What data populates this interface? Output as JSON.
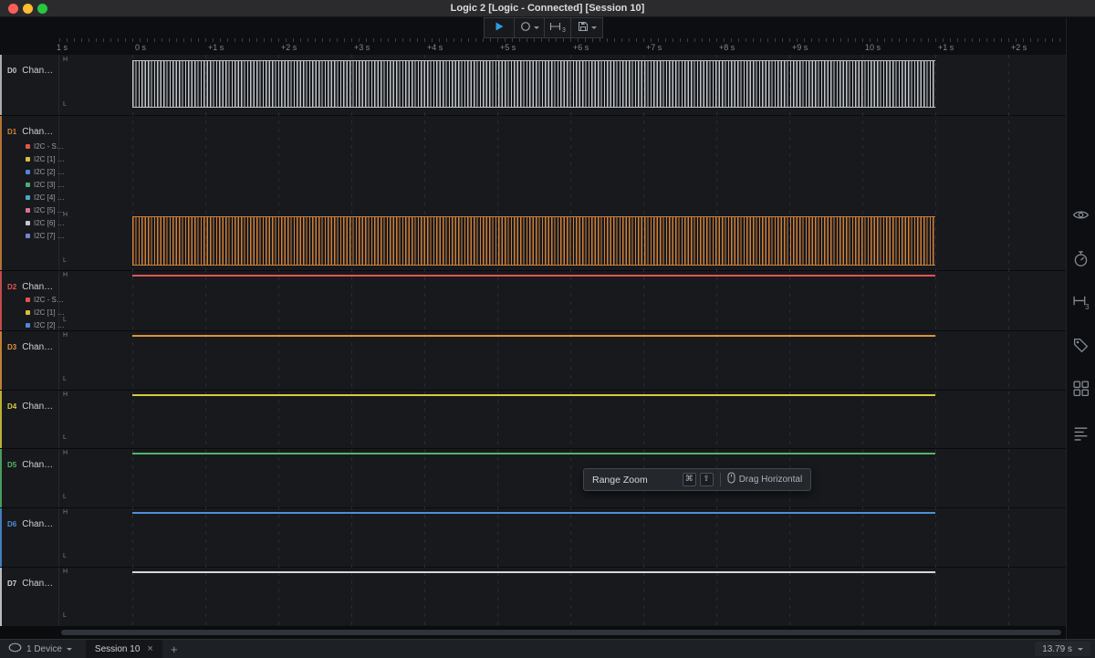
{
  "window": {
    "title": "Logic 2 [Logic - Connected] [Session 10]"
  },
  "toolbar": {
    "measurements_badge": "3"
  },
  "icons": {
    "play-icon": "▶",
    "capture-mode-icon": "◯",
    "measurements-icon": "⊢⊣",
    "export-icon": "💾",
    "chevron-down-icon": "▾",
    "eye-icon": "👁",
    "timer-icon": "⏱",
    "labels-icon": "🏷",
    "extensions-icon": "▦",
    "notes-icon": "≡",
    "mouse-icon": "🖱",
    "device-icon": "⬭",
    "close-icon": "×",
    "plus-icon": "+"
  },
  "ruler": {
    "labels": [
      "1 s",
      "0 s",
      "+1 s",
      "+2 s",
      "+3 s",
      "+4 s",
      "+5 s",
      "+6 s",
      "+7 s",
      "+8 s",
      "+9 s",
      "10 s",
      "+1 s",
      "+2 s"
    ]
  },
  "levels": {
    "high": "H",
    "low": "L"
  },
  "channels": [
    {
      "id": "D0",
      "name": "Chan…",
      "color": "#c2c5c9",
      "signal": "dense",
      "analyzers": []
    },
    {
      "id": "D1",
      "name": "Chan…",
      "color": "#d08038",
      "signal": "dense",
      "analyzers": [
        {
          "label": "I2C - S…",
          "color": "#e0564a"
        },
        {
          "label": "I2C [1] …",
          "color": "#d9bf3e"
        },
        {
          "label": "I2C [2] …",
          "color": "#4f86d8"
        },
        {
          "label": "I2C [3] …",
          "color": "#4cae6a"
        },
        {
          "label": "I2C [4] …",
          "color": "#49a8c8"
        },
        {
          "label": "I2C [5] …",
          "color": "#e0708e"
        },
        {
          "label": "I2C [6] …",
          "color": "#c4c8cc"
        },
        {
          "label": "I2C [7] …",
          "color": "#6f86d8"
        }
      ]
    },
    {
      "id": "D2",
      "name": "Chan…",
      "color": "#e05555",
      "signal": "line",
      "analyzers": [
        {
          "label": "I2C - S…",
          "color": "#e0564a"
        },
        {
          "label": "I2C [1] …",
          "color": "#d9bf3e"
        },
        {
          "label": "I2C [2] …",
          "color": "#4f86d8"
        }
      ]
    },
    {
      "id": "D3",
      "name": "Chan…",
      "color": "#e0913c",
      "signal": "line",
      "analyzers": []
    },
    {
      "id": "D4",
      "name": "Chan…",
      "color": "#d6cb3a",
      "signal": "line",
      "analyzers": []
    },
    {
      "id": "D5",
      "name": "Chan…",
      "color": "#53b568",
      "signal": "line",
      "analyzers": []
    },
    {
      "id": "D6",
      "name": "Chan…",
      "color": "#4e8fd6",
      "signal": "line",
      "analyzers": []
    },
    {
      "id": "D7",
      "name": "Chan…",
      "color": "#d4d7da",
      "signal": "line",
      "analyzers": []
    }
  ],
  "tooltip": {
    "title": "Range Zoom",
    "keys": [
      "⌘",
      "⇧"
    ],
    "action": "Drag Horizontal"
  },
  "statusbar": {
    "device_label": "1 Device",
    "session_tab": "Session 10",
    "close_tab": "×",
    "new_tab": "+",
    "duration": "13.79 s"
  }
}
